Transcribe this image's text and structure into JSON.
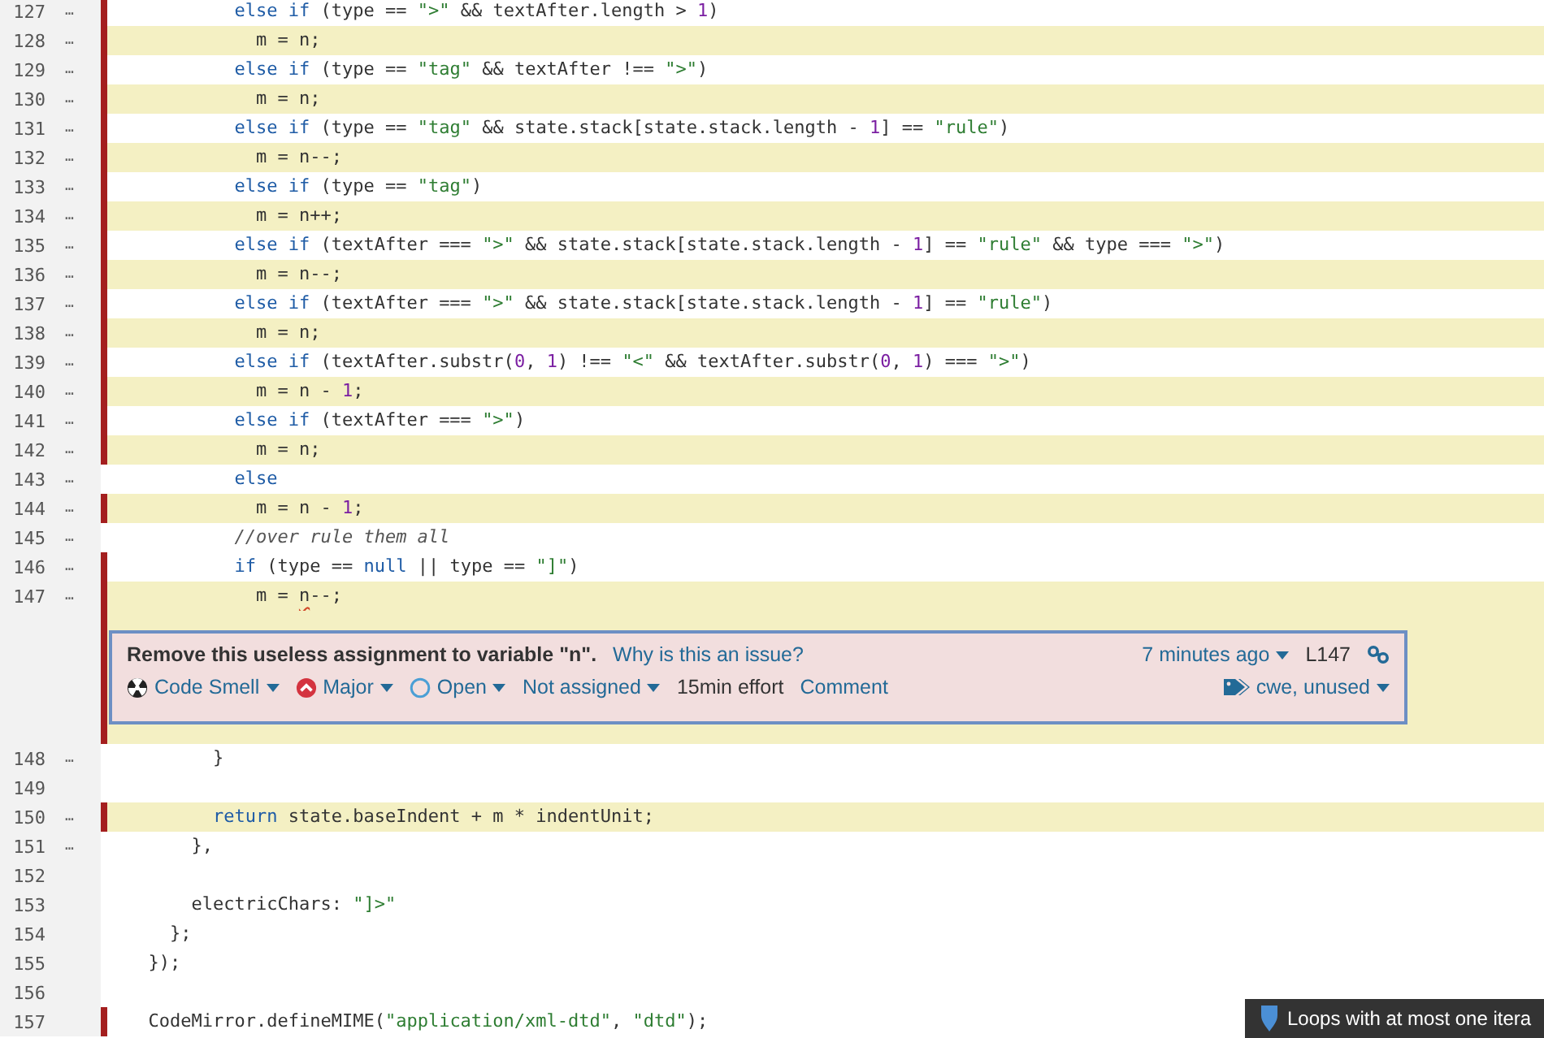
{
  "lines": [
    {
      "number": "127",
      "more": "…",
      "flagged": true,
      "highlighted": false,
      "tokens": [
        {
          "kind": "keyword",
          "text": "          else if"
        },
        {
          "kind": "plain",
          "text": " (type == "
        },
        {
          "kind": "string",
          "text": "\">\""
        },
        {
          "kind": "plain",
          "text": " && textAfter.length > "
        },
        {
          "kind": "number",
          "text": "1"
        },
        {
          "kind": "plain",
          "text": ")"
        }
      ]
    },
    {
      "number": "128",
      "more": "…",
      "flagged": true,
      "highlighted": true,
      "tokens": [
        {
          "kind": "plain",
          "text": "            m = n;"
        }
      ]
    },
    {
      "number": "129",
      "more": "…",
      "flagged": true,
      "highlighted": false,
      "tokens": [
        {
          "kind": "keyword",
          "text": "          else if"
        },
        {
          "kind": "plain",
          "text": " (type == "
        },
        {
          "kind": "string",
          "text": "\"tag\""
        },
        {
          "kind": "plain",
          "text": " && textAfter !== "
        },
        {
          "kind": "string",
          "text": "\">\""
        },
        {
          "kind": "plain",
          "text": ")"
        }
      ]
    },
    {
      "number": "130",
      "more": "…",
      "flagged": true,
      "highlighted": true,
      "tokens": [
        {
          "kind": "plain",
          "text": "            m = n;"
        }
      ]
    },
    {
      "number": "131",
      "more": "…",
      "flagged": true,
      "highlighted": false,
      "tokens": [
        {
          "kind": "keyword",
          "text": "          else if"
        },
        {
          "kind": "plain",
          "text": " (type == "
        },
        {
          "kind": "string",
          "text": "\"tag\""
        },
        {
          "kind": "plain",
          "text": " && state.stack[state.stack.length - "
        },
        {
          "kind": "number",
          "text": "1"
        },
        {
          "kind": "plain",
          "text": "] == "
        },
        {
          "kind": "string",
          "text": "\"rule\""
        },
        {
          "kind": "plain",
          "text": ")"
        }
      ]
    },
    {
      "number": "132",
      "more": "…",
      "flagged": true,
      "highlighted": true,
      "tokens": [
        {
          "kind": "plain",
          "text": "            m = n--;"
        }
      ]
    },
    {
      "number": "133",
      "more": "…",
      "flagged": true,
      "highlighted": false,
      "tokens": [
        {
          "kind": "keyword",
          "text": "          else if"
        },
        {
          "kind": "plain",
          "text": " (type == "
        },
        {
          "kind": "string",
          "text": "\"tag\""
        },
        {
          "kind": "plain",
          "text": ")"
        }
      ]
    },
    {
      "number": "134",
      "more": "…",
      "flagged": true,
      "highlighted": true,
      "tokens": [
        {
          "kind": "plain",
          "text": "            m = n++;"
        }
      ]
    },
    {
      "number": "135",
      "more": "…",
      "flagged": true,
      "highlighted": false,
      "tokens": [
        {
          "kind": "keyword",
          "text": "          else if"
        },
        {
          "kind": "plain",
          "text": " (textAfter === "
        },
        {
          "kind": "string",
          "text": "\">\""
        },
        {
          "kind": "plain",
          "text": " && state.stack[state.stack.length - "
        },
        {
          "kind": "number",
          "text": "1"
        },
        {
          "kind": "plain",
          "text": "] == "
        },
        {
          "kind": "string",
          "text": "\"rule\""
        },
        {
          "kind": "plain",
          "text": " && type === "
        },
        {
          "kind": "string",
          "text": "\">\""
        },
        {
          "kind": "plain",
          "text": ")"
        }
      ]
    },
    {
      "number": "136",
      "more": "…",
      "flagged": true,
      "highlighted": true,
      "tokens": [
        {
          "kind": "plain",
          "text": "            m = n--;"
        }
      ]
    },
    {
      "number": "137",
      "more": "…",
      "flagged": true,
      "highlighted": false,
      "tokens": [
        {
          "kind": "keyword",
          "text": "          else if"
        },
        {
          "kind": "plain",
          "text": " (textAfter === "
        },
        {
          "kind": "string",
          "text": "\">\""
        },
        {
          "kind": "plain",
          "text": " && state.stack[state.stack.length - "
        },
        {
          "kind": "number",
          "text": "1"
        },
        {
          "kind": "plain",
          "text": "] == "
        },
        {
          "kind": "string",
          "text": "\"rule\""
        },
        {
          "kind": "plain",
          "text": ")"
        }
      ]
    },
    {
      "number": "138",
      "more": "…",
      "flagged": true,
      "highlighted": true,
      "tokens": [
        {
          "kind": "plain",
          "text": "            m = n;"
        }
      ]
    },
    {
      "number": "139",
      "more": "…",
      "flagged": true,
      "highlighted": false,
      "tokens": [
        {
          "kind": "keyword",
          "text": "          else if"
        },
        {
          "kind": "plain",
          "text": " (textAfter.substr("
        },
        {
          "kind": "number",
          "text": "0"
        },
        {
          "kind": "plain",
          "text": ", "
        },
        {
          "kind": "number",
          "text": "1"
        },
        {
          "kind": "plain",
          "text": ") !== "
        },
        {
          "kind": "string",
          "text": "\"<\""
        },
        {
          "kind": "plain",
          "text": " && textAfter.substr("
        },
        {
          "kind": "number",
          "text": "0"
        },
        {
          "kind": "plain",
          "text": ", "
        },
        {
          "kind": "number",
          "text": "1"
        },
        {
          "kind": "plain",
          "text": ") === "
        },
        {
          "kind": "string",
          "text": "\">\""
        },
        {
          "kind": "plain",
          "text": ")"
        }
      ]
    },
    {
      "number": "140",
      "more": "…",
      "flagged": true,
      "highlighted": true,
      "tokens": [
        {
          "kind": "plain",
          "text": "            m = n - "
        },
        {
          "kind": "number",
          "text": "1"
        },
        {
          "kind": "plain",
          "text": ";"
        }
      ]
    },
    {
      "number": "141",
      "more": "…",
      "flagged": true,
      "highlighted": false,
      "tokens": [
        {
          "kind": "keyword",
          "text": "          else if"
        },
        {
          "kind": "plain",
          "text": " (textAfter === "
        },
        {
          "kind": "string",
          "text": "\">\""
        },
        {
          "kind": "plain",
          "text": ")"
        }
      ]
    },
    {
      "number": "142",
      "more": "…",
      "flagged": true,
      "highlighted": true,
      "tokens": [
        {
          "kind": "plain",
          "text": "            m = n;"
        }
      ]
    },
    {
      "number": "143",
      "more": "…",
      "flagged": false,
      "highlighted": false,
      "tokens": [
        {
          "kind": "keyword",
          "text": "          else"
        }
      ]
    },
    {
      "number": "144",
      "more": "…",
      "flagged": true,
      "highlighted": true,
      "tokens": [
        {
          "kind": "plain",
          "text": "            m = n - "
        },
        {
          "kind": "number",
          "text": "1"
        },
        {
          "kind": "plain",
          "text": ";"
        }
      ]
    },
    {
      "number": "145",
      "more": "…",
      "flagged": false,
      "highlighted": false,
      "tokens": [
        {
          "kind": "comment",
          "text": "          //over rule them all"
        }
      ]
    },
    {
      "number": "146",
      "more": "…",
      "flagged": true,
      "highlighted": false,
      "tokens": [
        {
          "kind": "keyword",
          "text": "          if"
        },
        {
          "kind": "plain",
          "text": " (type == "
        },
        {
          "kind": "keyword",
          "text": "null"
        },
        {
          "kind": "plain",
          "text": " || type == "
        },
        {
          "kind": "string",
          "text": "\"]\""
        },
        {
          "kind": "plain",
          "text": ")"
        }
      ]
    },
    {
      "number": "147",
      "more": "…",
      "flagged": true,
      "highlighted": true,
      "tokens": [
        {
          "kind": "plain",
          "text": "            m = "
        },
        {
          "kind": "flagged",
          "text": "n"
        },
        {
          "kind": "plain",
          "text": "--;"
        }
      ],
      "issue": {
        "message": "Remove this useless assignment to variable \"n\".",
        "why": "Why is this an issue?",
        "age": "7 minutes ago",
        "line_ref": "L147",
        "attributes": [
          {
            "kind": "type",
            "label": "Code Smell"
          },
          {
            "kind": "severity",
            "label": "Major"
          },
          {
            "kind": "status",
            "label": "Open"
          },
          {
            "kind": "assignee",
            "label": "Not assigned"
          }
        ],
        "effort": "15min effort",
        "comment": "Comment",
        "tags": "cwe, unused"
      }
    },
    {
      "number": "148",
      "more": "…",
      "flagged": false,
      "highlighted": false,
      "tokens": [
        {
          "kind": "plain",
          "text": "        }"
        }
      ]
    },
    {
      "number": "149",
      "flagged": false,
      "highlighted": false
    },
    {
      "number": "150",
      "more": "…",
      "flagged": true,
      "highlighted": true,
      "tokens": [
        {
          "kind": "keyword",
          "text": "        return"
        },
        {
          "kind": "plain",
          "text": " state.baseIndent + m * indentUnit;"
        }
      ]
    },
    {
      "number": "151",
      "more": "…",
      "flagged": false,
      "highlighted": false,
      "tokens": [
        {
          "kind": "plain",
          "text": "      },"
        }
      ]
    },
    {
      "number": "152",
      "flagged": false,
      "highlighted": false
    },
    {
      "number": "153",
      "flagged": false,
      "highlighted": false,
      "tokens": [
        {
          "kind": "plain",
          "text": "      electricChars: "
        },
        {
          "kind": "string",
          "text": "\"]>\""
        }
      ]
    },
    {
      "number": "154",
      "flagged": false,
      "highlighted": false,
      "tokens": [
        {
          "kind": "plain",
          "text": "    };"
        }
      ]
    },
    {
      "number": "155",
      "flagged": false,
      "highlighted": false,
      "tokens": [
        {
          "kind": "plain",
          "text": "  });"
        }
      ]
    },
    {
      "number": "156",
      "flagged": false,
      "highlighted": false
    },
    {
      "number": "157",
      "flagged": true,
      "highlighted": false,
      "tokens": [
        {
          "kind": "plain",
          "text": "  CodeMirror.defineMIME("
        },
        {
          "kind": "string",
          "text": "\"application/xml-dtd\""
        },
        {
          "kind": "plain",
          "text": ", "
        },
        {
          "kind": "string",
          "text": "\"dtd\""
        },
        {
          "kind": "plain",
          "text": ");"
        }
      ]
    }
  ],
  "tooltip": {
    "text": "Loops with at most one itera"
  }
}
